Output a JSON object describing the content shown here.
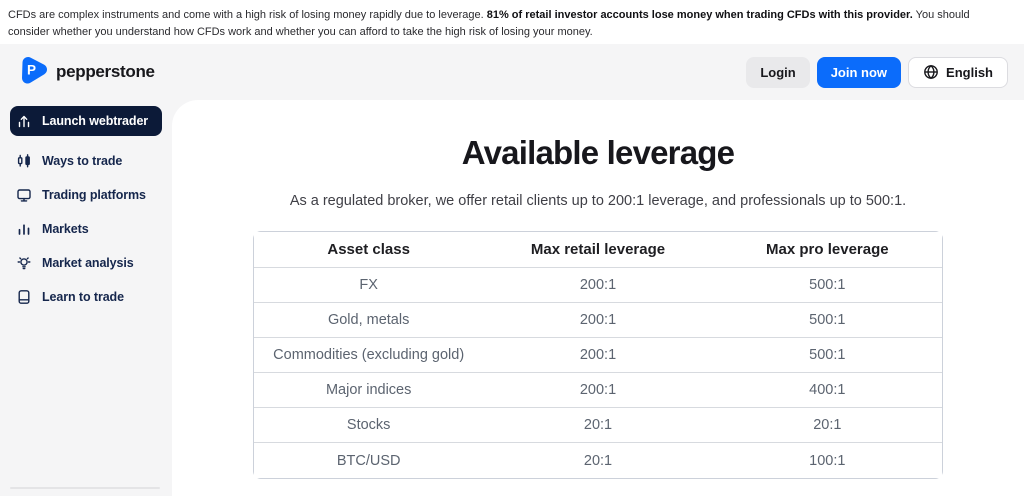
{
  "banner": {
    "text_before": "CFDs are complex instruments and come with a high risk of losing money rapidly due to leverage. ",
    "text_bold": "81% of retail investor accounts lose money when trading CFDs with this provider.",
    "text_after": " You should consider whether you understand how CFDs work and whether you can afford to take the high risk of losing your money."
  },
  "header": {
    "brand": "pepperstone",
    "login_label": "Login",
    "join_label": "Join now",
    "language_label": "English"
  },
  "sidebar": {
    "items": [
      {
        "label": "Launch webtrader",
        "icon": "chart-launch-icon",
        "active": true
      },
      {
        "label": "Ways to trade",
        "icon": "candlestick-icon",
        "active": false
      },
      {
        "label": "Trading platforms",
        "icon": "monitor-icon",
        "active": false
      },
      {
        "label": "Markets",
        "icon": "bar-chart-icon",
        "active": false
      },
      {
        "label": "Market analysis",
        "icon": "lightbulb-icon",
        "active": false
      },
      {
        "label": "Learn to trade",
        "icon": "book-icon",
        "active": false
      }
    ]
  },
  "main": {
    "title": "Available leverage",
    "subtitle": "As a regulated broker, we offer retail clients up to 200:1 leverage, and professionals up to 500:1.",
    "table": {
      "headers": [
        "Asset class",
        "Max retail leverage",
        "Max pro leverage"
      ],
      "rows": [
        [
          "FX",
          "200:1",
          "500:1"
        ],
        [
          "Gold, metals",
          "200:1",
          "500:1"
        ],
        [
          "Commodities (excluding gold)",
          "200:1",
          "500:1"
        ],
        [
          "Major indices",
          "200:1",
          "400:1"
        ],
        [
          "Stocks",
          "20:1",
          "20:1"
        ],
        [
          "BTC/USD",
          "20:1",
          "100:1"
        ]
      ]
    }
  },
  "colors": {
    "accent_blue": "#0b6cfb",
    "navy": "#0c1a38",
    "header_bg": "#f5f5f6"
  }
}
